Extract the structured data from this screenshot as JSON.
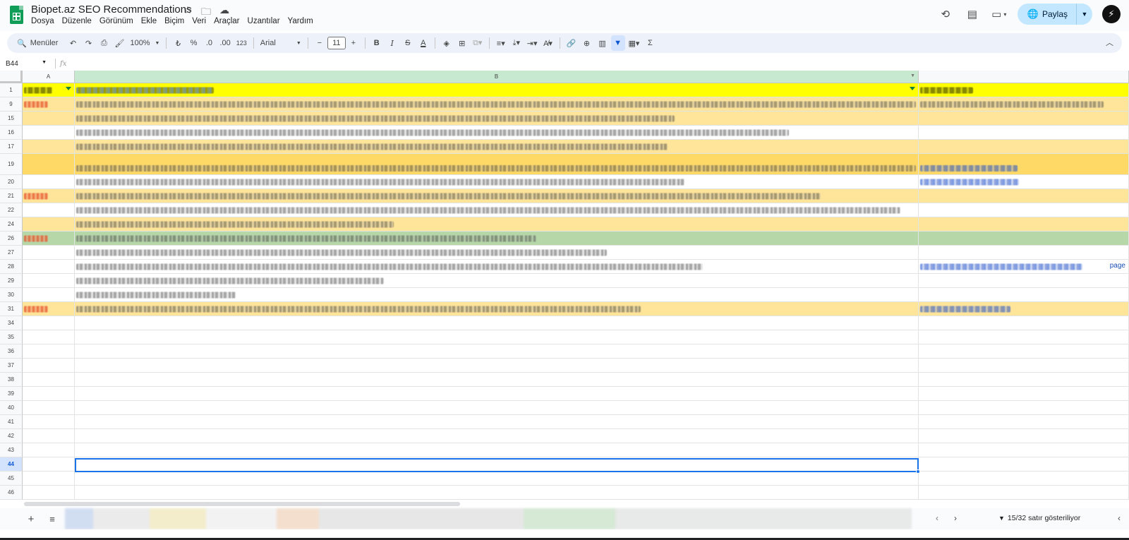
{
  "app": {
    "title": "Biopet.az SEO Recommendations",
    "menu": [
      "Dosya",
      "Düzenle",
      "Görünüm",
      "Ekle",
      "Biçim",
      "Veri",
      "Araçlar",
      "Uzantılar",
      "Yardım"
    ],
    "share_label": "Paylaş",
    "avatar_glyph": "⚡"
  },
  "toolbar": {
    "search_label": "Menüler",
    "zoom": "100%",
    "currency": "₺",
    "percent": "%",
    "dec_decrease": ".0",
    "dec_increase": ".00",
    "number_format": "123",
    "font": "Arial",
    "font_size": "11",
    "bold": "B",
    "italic": "I",
    "strike": "S",
    "text_color": "A",
    "sigma": "Σ"
  },
  "formula_bar": {
    "cell_ref": "B44",
    "fx": "fx"
  },
  "columns": [
    "A",
    "B"
  ],
  "rows": [
    {
      "num": "1",
      "bg": "#ffff00",
      "a": "hdr",
      "b": "hdrlink",
      "c": "hdr",
      "aw": 40,
      "bw": 195,
      "cw": 75,
      "filter": true
    },
    {
      "num": "9",
      "bg": "#ffe599",
      "a": "red",
      "b": "grey",
      "c": "grey",
      "aw": 34,
      "bw": 1190,
      "cw": 260
    },
    {
      "num": "15",
      "bg": "#ffe599",
      "a": "",
      "b": "grey",
      "c": "",
      "aw": 0,
      "bw": 848,
      "cw": 0
    },
    {
      "num": "16",
      "bg": "#ffffff",
      "a": "",
      "b": "grey",
      "c": "",
      "aw": 0,
      "bw": 1010,
      "cw": 0
    },
    {
      "num": "17",
      "bg": "#ffe599",
      "a": "",
      "b": "grey",
      "c": "",
      "aw": 0,
      "bw": 838,
      "cw": 0
    },
    {
      "num": "19",
      "bg": "#ffd966",
      "a": "",
      "b": "grey",
      "c": "link",
      "aw": 0,
      "bw": 1190,
      "cw": 138,
      "tall": true
    },
    {
      "num": "20",
      "bg": "#ffffff",
      "a": "",
      "b": "grey",
      "c": "link",
      "aw": 0,
      "bw": 862,
      "cw": 140
    },
    {
      "num": "21",
      "bg": "#ffe599",
      "a": "red",
      "b": "grey",
      "c": "",
      "aw": 34,
      "bw": 1055,
      "cw": 0
    },
    {
      "num": "22",
      "bg": "#ffffff",
      "a": "",
      "b": "grey",
      "c": "",
      "aw": 0,
      "bw": 1168,
      "cw": 0
    },
    {
      "num": "24",
      "bg": "#ffe599",
      "a": "",
      "b": "grey",
      "c": "",
      "aw": 0,
      "bw": 450,
      "cw": 0
    },
    {
      "num": "26",
      "bg": "#b6d7a8",
      "a": "red",
      "b": "grey",
      "c": "",
      "aw": 34,
      "bw": 652,
      "cw": 0
    },
    {
      "num": "27",
      "bg": "#ffffff",
      "a": "",
      "b": "grey",
      "c": "",
      "aw": 0,
      "bw": 752,
      "cw": 0
    },
    {
      "num": "28",
      "bg": "#ffffff",
      "a": "",
      "b": "grey",
      "c": "link",
      "aw": 0,
      "bw": 888,
      "cw": 230,
      "c_tail": "page"
    },
    {
      "num": "29",
      "bg": "#ffffff",
      "a": "",
      "b": "grey",
      "c": "",
      "aw": 0,
      "bw": 436,
      "cw": 0
    },
    {
      "num": "30",
      "bg": "#ffffff",
      "a": "",
      "b": "grey",
      "c": "",
      "aw": 0,
      "bw": 226,
      "cw": 0
    },
    {
      "num": "31",
      "bg": "#ffe599",
      "a": "red",
      "b": "grey",
      "c": "link",
      "aw": 34,
      "bw": 800,
      "cw": 128
    },
    {
      "num": "34"
    },
    {
      "num": "35"
    },
    {
      "num": "36"
    },
    {
      "num": "37"
    },
    {
      "num": "38"
    },
    {
      "num": "39"
    },
    {
      "num": "40"
    },
    {
      "num": "41"
    },
    {
      "num": "42"
    },
    {
      "num": "43"
    },
    {
      "num": "44",
      "active": true
    },
    {
      "num": "45"
    },
    {
      "num": "46"
    }
  ],
  "status": {
    "rows_shown": "15/32 satır gösteriliyor"
  },
  "colors": {
    "header_yellow": "#ffff00",
    "light_yellow": "#ffe599",
    "mid_yellow": "#ffd966",
    "green_row": "#b6d7a8",
    "accent_blue": "#1a73e8",
    "share_bg": "#c2e7ff"
  }
}
